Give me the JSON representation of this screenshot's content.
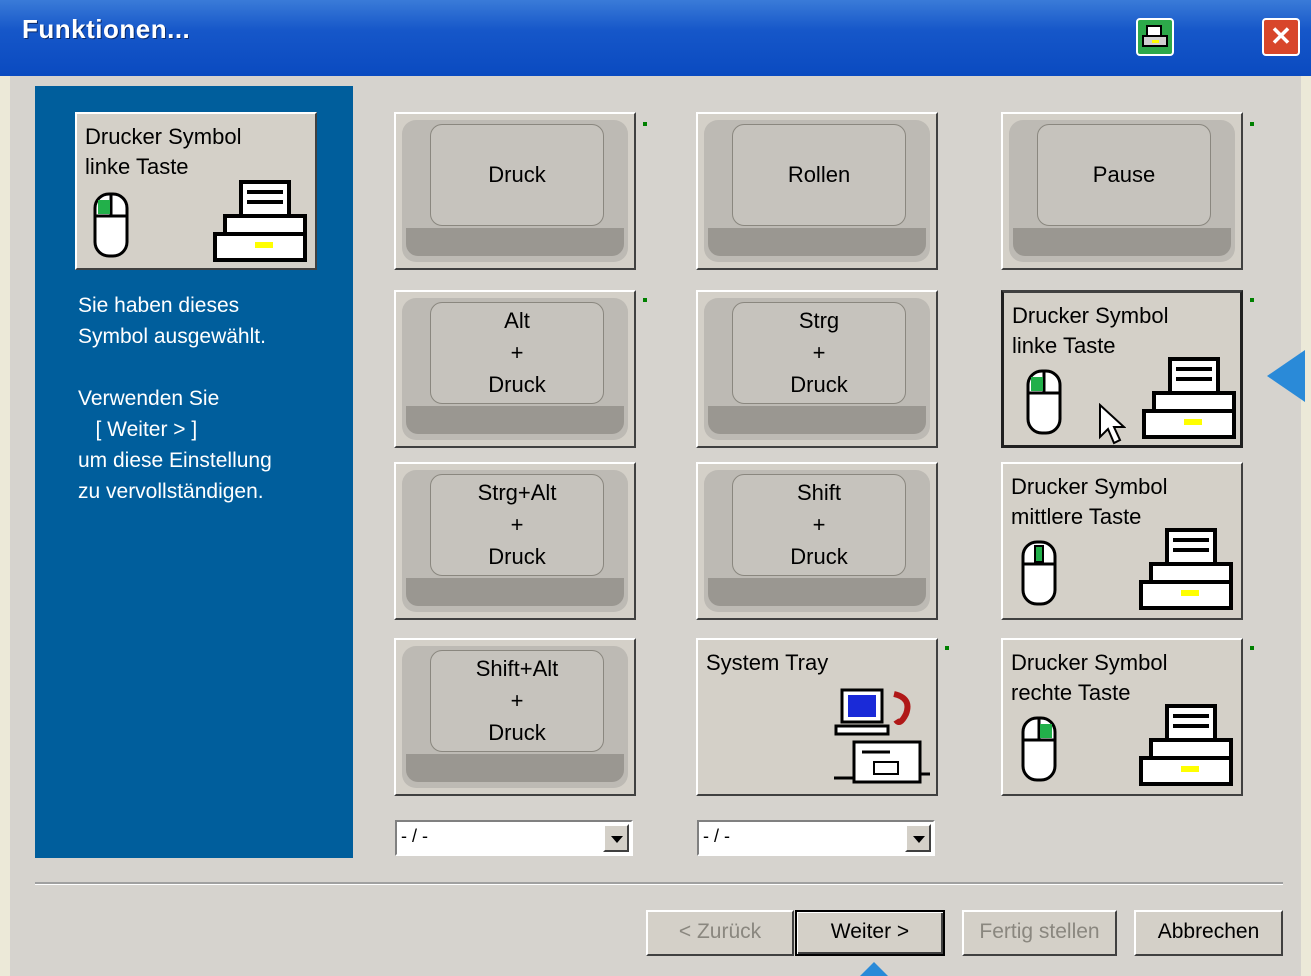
{
  "window": {
    "title": "Funktionen..."
  },
  "selected": {
    "label_line1": "Drucker Symbol",
    "label_line2": "linke Taste"
  },
  "info": {
    "line1": "Sie haben dieses",
    "line2": "Symbol ausgewählt.",
    "line3": "Verwenden Sie",
    "line4": "   [ Weiter > ]",
    "line5": "um diese Einstellung",
    "line6": "zu vervollständigen."
  },
  "keys": {
    "druck": "Druck",
    "rollen": "Rollen",
    "pause": "Pause",
    "alt": "Alt",
    "strg": "Strg",
    "strg_alt": "Strg+Alt",
    "shift": "Shift",
    "shift_alt": "Shift+Alt",
    "plus": "+"
  },
  "cards": {
    "left_1": "Drucker Symbol",
    "left_2": "linke Taste",
    "middle_1": "Drucker Symbol",
    "middle_2": "mittlere Taste",
    "right_1": "Drucker Symbol",
    "right_2": "rechte Taste",
    "tray": "System Tray"
  },
  "combos": {
    "left_value": "- / -",
    "right_value": "- / -"
  },
  "buttons": {
    "back": "< Zurück",
    "next": "Weiter >",
    "finish": "Fertig stellen",
    "cancel": "Abbrechen"
  }
}
